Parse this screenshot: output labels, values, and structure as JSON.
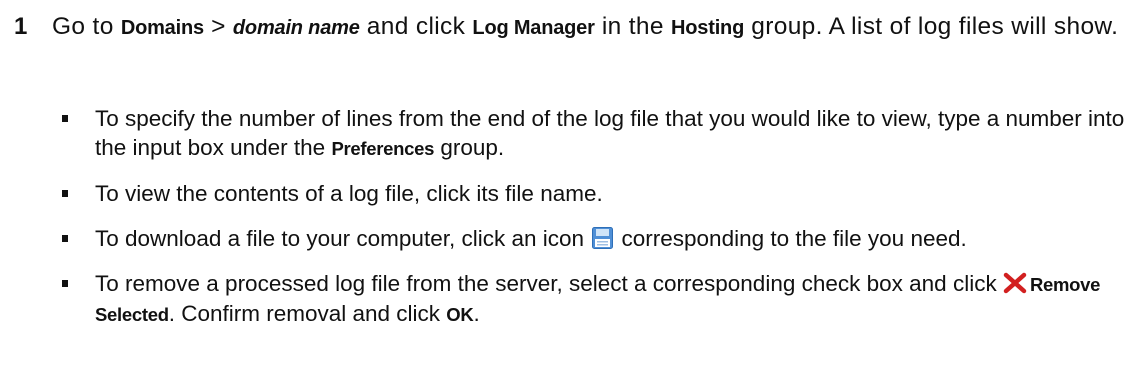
{
  "step": {
    "number": "1",
    "go_to": "Go to ",
    "domains": "Domains",
    "sep": " > ",
    "domain_name": "domain name",
    "and_click": " and click ",
    "log_manager": "Log Manager",
    "in_the": " in the ",
    "hosting": "Hosting",
    "tail": " group. A list of log files will show."
  },
  "bullets": {
    "b1_pre": "To specify the number of lines from the end of the log file that you would like to view, type a number into the input box under the ",
    "b1_ui": "Preferences",
    "b1_post": " group.",
    "b2": "To view the contents of a log file, click its file name.",
    "b3_pre": "To download a file to your computer, click an icon ",
    "b3_post": " corresponding to the file you need.",
    "b4_pre": "To remove a processed log file from the server, select a corresponding check box and click ",
    "b4_ui": "Remove Selected",
    "b4_mid": ". Confirm removal and click ",
    "b4_ok": "OK",
    "b4_end": "."
  },
  "icons": {
    "download": "save-icon",
    "remove": "remove-icon",
    "colors": {
      "save_blue": "#4f8fd6",
      "save_light": "#cfe4f8",
      "remove_red": "#d22020"
    }
  }
}
